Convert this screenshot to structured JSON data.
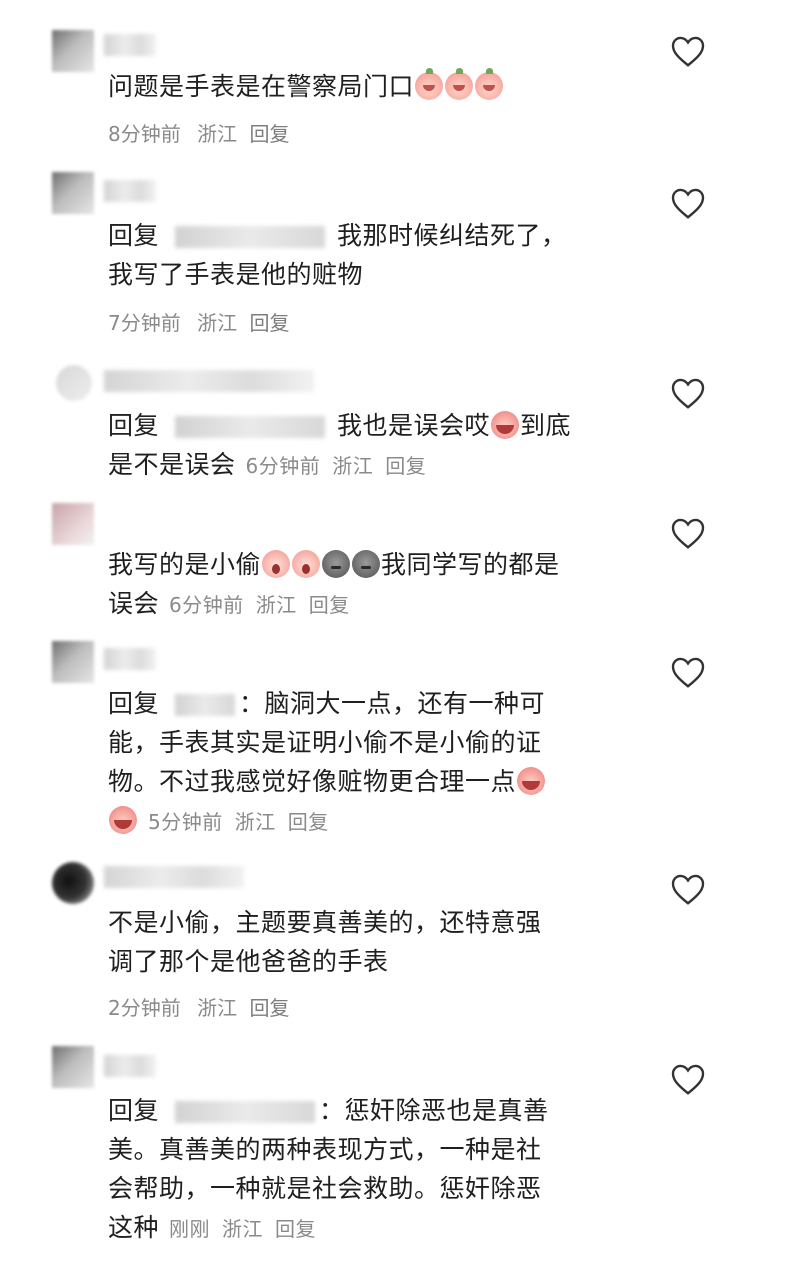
{
  "comments": [
    {
      "lines": [
        "问题是手表是在警察局门口"
      ],
      "emojis": [
        "peach-face-emoji",
        "peach-face-emoji",
        "peach-face-emoji"
      ],
      "time": "8分钟前",
      "location": "浙江",
      "reply": "回复"
    },
    {
      "reply_prefix": "回复",
      "lines": [
        "我那时候纠结死了，",
        "我写了手表是他的赃物"
      ],
      "time": "7分钟前",
      "location": "浙江",
      "reply": "回复"
    },
    {
      "reply_prefix": "回复",
      "lines": [
        "我也是误会哎",
        "到底",
        "是不是误会"
      ],
      "emojis": [
        "crying-peach-emoji"
      ],
      "time": "6分钟前",
      "location": "浙江",
      "reply": "回复"
    },
    {
      "lines": [
        "我写的是小偷",
        "我同学写的都是",
        "误会"
      ],
      "emojis": [
        "screaming-face-emoji",
        "screaming-face-emoji",
        "gray-face-emoji",
        "gray-face-emoji"
      ],
      "time": "6分钟前",
      "location": "浙江",
      "reply": "回复"
    },
    {
      "reply_prefix": "回复",
      "lines": [
        "：脑洞大一点，还有一种可",
        "能，手表其实是证明小偷不是小偷的证",
        "物。不过我感觉好像赃物更合理一点"
      ],
      "emojis": [
        "crying-peach-emoji",
        "crying-peach-emoji"
      ],
      "time": "5分钟前",
      "location": "浙江",
      "reply": "回复"
    },
    {
      "lines": [
        "不是小偷，主题要真善美的，还特意强",
        "调了那个是他爸爸的手表"
      ],
      "time": "2分钟前",
      "location": "浙江",
      "reply": "回复"
    },
    {
      "reply_prefix": "回复",
      "lines": [
        "：惩奸除恶也是真善",
        "美。真善美的两种表现方式，一种是社",
        "会帮助，一种就是社会救助。惩奸除恶",
        "这种"
      ],
      "time": "刚刚",
      "location": "浙江",
      "reply": "回复"
    }
  ],
  "icons": {
    "like": "heart-outline-icon"
  }
}
